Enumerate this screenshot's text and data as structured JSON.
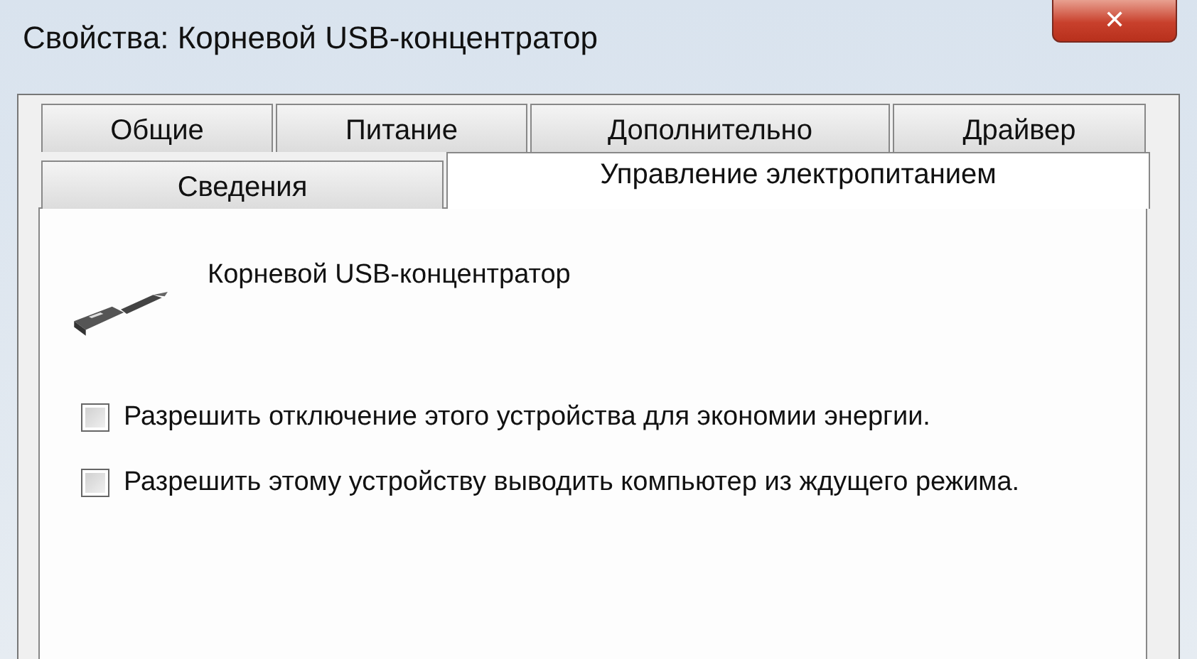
{
  "window": {
    "title": "Свойства: Корневой USB-концентратор",
    "close": "✕"
  },
  "tab_rows": [
    [
      {
        "label": "Общие",
        "selected": false
      },
      {
        "label": "Питание",
        "selected": false
      },
      {
        "label": "Дополнительно",
        "selected": false
      },
      {
        "label": "Драйвер",
        "selected": false
      }
    ],
    [
      {
        "label": "Сведения",
        "selected": false
      },
      {
        "label": "Управление электропитанием",
        "selected": true
      }
    ]
  ],
  "device": {
    "name": "Корневой USB-концентратор"
  },
  "options": [
    {
      "label": "Разрешить отключение этого устройства для экономии энергии.",
      "checked": false
    },
    {
      "label": "Разрешить этому устройству выводить компьютер из ждущего режима.",
      "checked": false
    }
  ]
}
